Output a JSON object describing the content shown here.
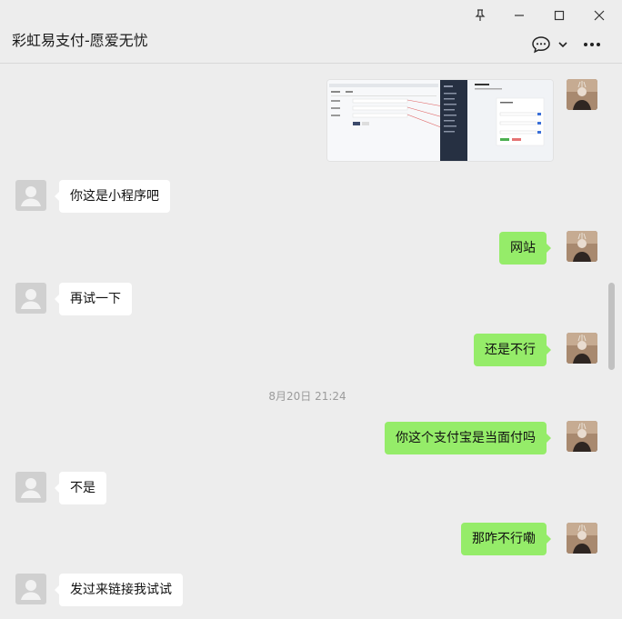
{
  "window": {
    "title": "彩虹易支付-愿爱无忧",
    "pin_icon": "pin-icon",
    "minimize_icon": "minimize-icon",
    "maximize_icon": "maximize-icon",
    "close_icon": "close-icon"
  },
  "header": {
    "chat_icon": "chat-bubble-icon",
    "dropdown_icon": "chevron-down-icon",
    "more_icon": "more-icon"
  },
  "messages": [
    {
      "side": "right",
      "type": "image"
    },
    {
      "side": "left",
      "text": "你这是小程序吧"
    },
    {
      "side": "right",
      "text": "网站"
    },
    {
      "side": "left",
      "text": "再试一下"
    },
    {
      "side": "right",
      "text": "还是不行"
    },
    {
      "side": "time",
      "text": "8月20日 21:24"
    },
    {
      "side": "right",
      "text": "你这个支付宝是当面付吗"
    },
    {
      "side": "left",
      "text": "不是"
    },
    {
      "side": "right",
      "text": "那咋不行嘞"
    },
    {
      "side": "left",
      "text": "发过来链接我试试"
    }
  ],
  "colors": {
    "background": "#ededed",
    "bubble_self": "#95ec69",
    "bubble_other": "#ffffff"
  }
}
